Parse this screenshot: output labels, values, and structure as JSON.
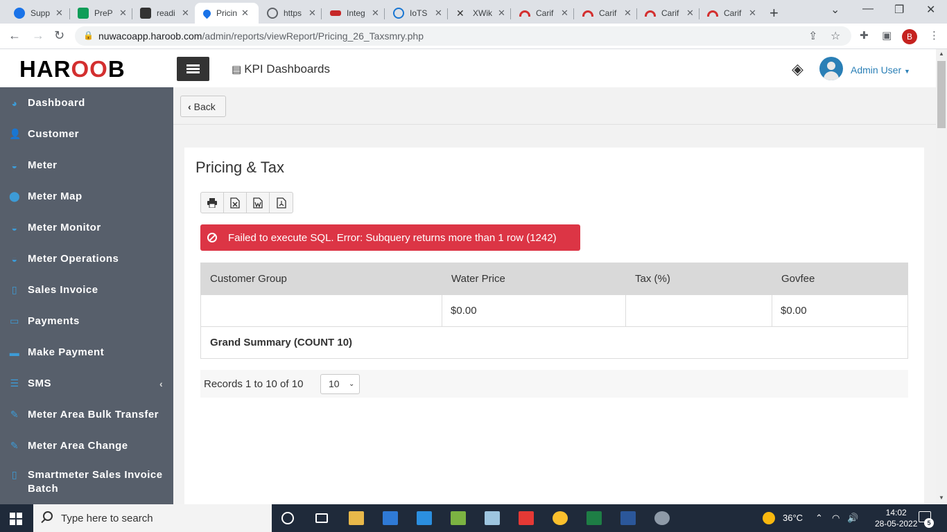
{
  "browser": {
    "tabs": [
      {
        "title": "Supp",
        "color": "#1a73e8"
      },
      {
        "title": "PreP",
        "color": "#0f9d58"
      },
      {
        "title": "readi",
        "color": "#333333"
      },
      {
        "title": "Pricin",
        "color": "#1a73e8",
        "active": true
      },
      {
        "title": "https",
        "color": "#5f6368"
      },
      {
        "title": "Integ",
        "color": "#c62828"
      },
      {
        "title": "IoTS",
        "color": "#1976d2"
      },
      {
        "title": "XWik",
        "color": "#333333"
      },
      {
        "title": "Carif",
        "color": "#d32f2f"
      },
      {
        "title": "Carif",
        "color": "#d32f2f"
      },
      {
        "title": "Carif",
        "color": "#d32f2f"
      },
      {
        "title": "Carif",
        "color": "#d32f2f"
      }
    ],
    "url_host": "nuwacoapp.haroob.com",
    "url_path": "/admin/reports/viewReport/Pricing_26_Taxsmry.php",
    "profile_initial": "B"
  },
  "header": {
    "logo_left": "HAR",
    "logo_mid": "OO",
    "logo_right": "B",
    "title": "KPI Dashboards",
    "user_label": "Admin User"
  },
  "sidebar": {
    "items": [
      {
        "label": "Dashboard",
        "icon": "pie-chart-icon"
      },
      {
        "label": "Customer",
        "icon": "user-icon"
      },
      {
        "label": "Meter",
        "icon": "gauge-icon"
      },
      {
        "label": "Meter Map",
        "icon": "map-marker-icon"
      },
      {
        "label": "Meter Monitor",
        "icon": "gauge-icon"
      },
      {
        "label": "Meter Operations",
        "icon": "gauge-icon"
      },
      {
        "label": "Sales Invoice",
        "icon": "file-icon"
      },
      {
        "label": "Payments",
        "icon": "money-icon"
      },
      {
        "label": "Make Payment",
        "icon": "credit-card-icon"
      },
      {
        "label": "SMS",
        "icon": "list-icon"
      },
      {
        "label": "Meter Area Bulk Transfer",
        "icon": "edit-icon"
      },
      {
        "label": "Meter Area Change",
        "icon": "edit-icon"
      },
      {
        "label": "Smartmeter Sales Invoice Batch",
        "icon": "file-icon"
      }
    ]
  },
  "main": {
    "back_label": "Back",
    "page_title": "Pricing & Tax",
    "error_message": "Failed to execute SQL. Error: Subquery returns more than 1 row (1242)",
    "table": {
      "headers": [
        "Customer Group",
        "Water Price",
        "Tax (%)",
        "Govfee"
      ],
      "rows": [
        [
          "",
          "$0.00",
          "",
          "$0.00"
        ]
      ],
      "summary": "Grand Summary (COUNT 10)"
    },
    "records_text": "Records 1 to 10 of 10",
    "page_size": "10"
  },
  "taskbar": {
    "search_placeholder": "Type here to search",
    "temperature": "36°C",
    "time": "14:02",
    "date": "28-05-2022",
    "notification_count": "5"
  }
}
